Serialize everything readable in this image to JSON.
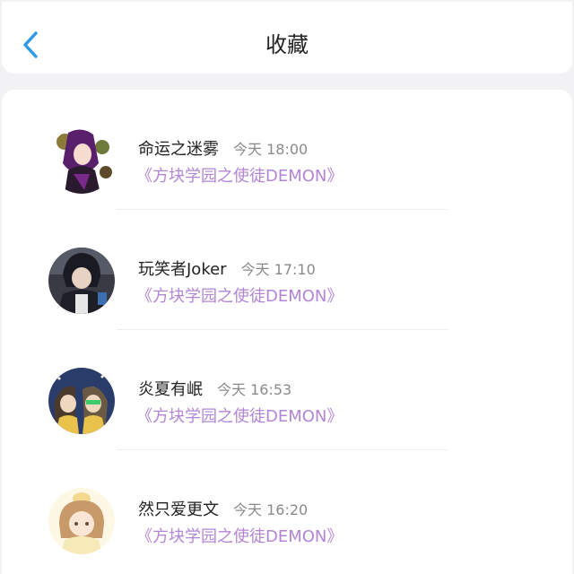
{
  "header": {
    "title": "收藏",
    "back_icon": "chevron-left-icon",
    "accent_color": "#2f9be8"
  },
  "items": [
    {
      "name": "命运之迷雾",
      "time": "今天 18:00",
      "work": "《方块学园之使徒DEMON》"
    },
    {
      "name": "玩笑者Joker",
      "time": "今天 17:10",
      "work": "《方块学园之使徒DEMON》"
    },
    {
      "name": "炎夏有岷",
      "time": "今天 16:53",
      "work": "《方块学园之使徒DEMON》"
    },
    {
      "name": "然只爱更文",
      "time": "今天 16:20",
      "work": "《方块学园之使徒DEMON》"
    }
  ],
  "colors": {
    "work_link": "#b385d6",
    "time": "#8a8a8a",
    "name": "#222222"
  }
}
